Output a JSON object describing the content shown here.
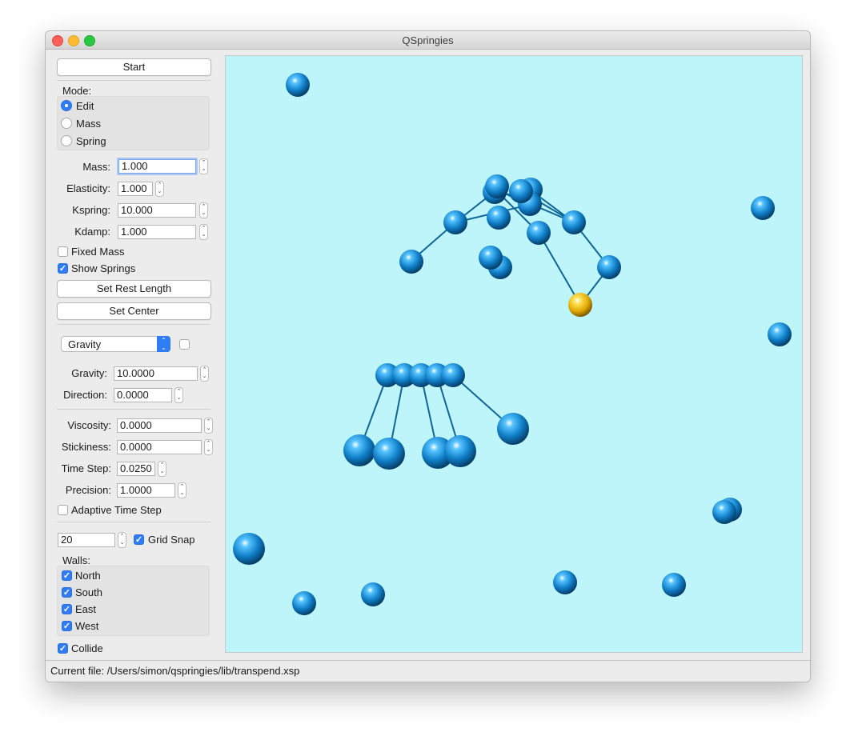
{
  "window": {
    "title": "QSpringies"
  },
  "controls": {
    "start_label": "Start",
    "mode_label": "Mode:",
    "modes": [
      "Edit",
      "Mass",
      "Spring"
    ],
    "selected_mode": "Edit",
    "mass_label": "Mass:",
    "mass_value": "1.000",
    "elasticity_label": "Elasticity:",
    "elasticity_value": "1.000",
    "kspring_label": "Kspring:",
    "kspring_value": "10.000",
    "kdamp_label": "Kdamp:",
    "kdamp_value": "1.000",
    "fixed_mass_label": "Fixed Mass",
    "fixed_mass_checked": false,
    "show_springs_label": "Show Springs",
    "show_springs_checked": true,
    "set_rest_length_label": "Set Rest Length",
    "set_center_label": "Set Center",
    "force_combo_value": "Gravity",
    "force_enabled": false,
    "gravity_label": "Gravity:",
    "gravity_value": "10.0000",
    "direction_label": "Direction:",
    "direction_value": "0.0000",
    "viscosity_label": "Viscosity:",
    "viscosity_value": "0.0000",
    "stickiness_label": "Stickiness:",
    "stickiness_value": "0.0000",
    "time_step_label": "Time Step:",
    "time_step_value": "0.0250",
    "precision_label": "Precision:",
    "precision_value": "1.0000",
    "adaptive_label": "Adaptive Time Step",
    "adaptive_checked": false,
    "grid_value": "20",
    "grid_snap_label": "Grid Snap",
    "grid_snap_checked": true,
    "walls_label": "Walls:",
    "walls": [
      {
        "label": "North",
        "checked": true
      },
      {
        "label": "South",
        "checked": true
      },
      {
        "label": "East",
        "checked": true
      },
      {
        "label": "West",
        "checked": true
      }
    ],
    "collide_label": "Collide",
    "collide_checked": true
  },
  "simulation": {
    "background": "#bdf5fb",
    "mass_color": "#1a7fc0",
    "selected_mass_color": "#e8b800",
    "spring_color": "#0f6596"
  },
  "statusbar": {
    "text": "Current file: /Users/simon/qspringies/lib/transpend.xsp"
  }
}
